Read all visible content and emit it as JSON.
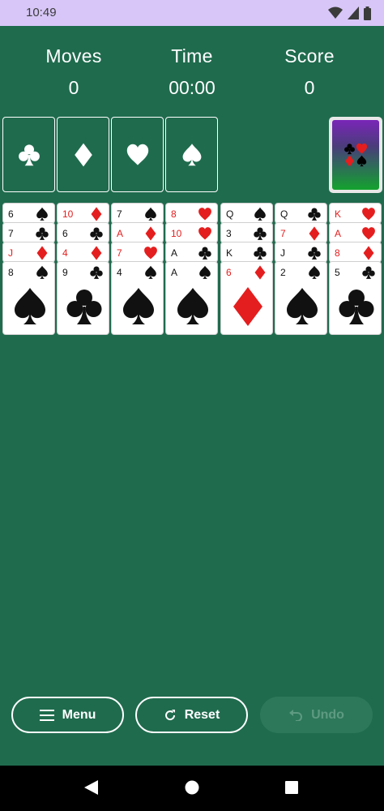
{
  "status_bar": {
    "time": "10:49"
  },
  "stats": {
    "moves": {
      "label": "Moves",
      "value": "0"
    },
    "time": {
      "label": "Time",
      "value": "00:00"
    },
    "score": {
      "label": "Score",
      "value": "0"
    }
  },
  "foundations": [
    "clubs",
    "diamonds",
    "hearts",
    "spades"
  ],
  "stock": {
    "back_icon": "four-suits-icon",
    "back_gradient": [
      "#7a25b8",
      "#14a22e"
    ]
  },
  "tableau": [
    {
      "cards": [
        {
          "rank": "6",
          "suit": "spades"
        },
        {
          "rank": "7",
          "suit": "clubs"
        },
        {
          "rank": "J",
          "suit": "diamonds"
        },
        {
          "rank": "8",
          "suit": "spades"
        }
      ]
    },
    {
      "cards": [
        {
          "rank": "10",
          "suit": "diamonds"
        },
        {
          "rank": "6",
          "suit": "clubs"
        },
        {
          "rank": "4",
          "suit": "diamonds"
        },
        {
          "rank": "9",
          "suit": "clubs"
        }
      ]
    },
    {
      "cards": [
        {
          "rank": "7",
          "suit": "spades"
        },
        {
          "rank": "A",
          "suit": "diamonds"
        },
        {
          "rank": "7",
          "suit": "hearts"
        },
        {
          "rank": "4",
          "suit": "spades"
        }
      ]
    },
    {
      "cards": [
        {
          "rank": "8",
          "suit": "hearts"
        },
        {
          "rank": "10",
          "suit": "hearts"
        },
        {
          "rank": "A",
          "suit": "clubs"
        },
        {
          "rank": "A",
          "suit": "spades"
        }
      ]
    },
    {
      "cards": [
        {
          "rank": "Q",
          "suit": "spades"
        },
        {
          "rank": "3",
          "suit": "clubs"
        },
        {
          "rank": "K",
          "suit": "clubs"
        },
        {
          "rank": "6",
          "suit": "diamonds"
        }
      ]
    },
    {
      "cards": [
        {
          "rank": "Q",
          "suit": "clubs"
        },
        {
          "rank": "7",
          "suit": "diamonds"
        },
        {
          "rank": "J",
          "suit": "clubs"
        },
        {
          "rank": "2",
          "suit": "spades"
        }
      ]
    },
    {
      "cards": [
        {
          "rank": "K",
          "suit": "hearts"
        },
        {
          "rank": "A",
          "suit": "hearts"
        },
        {
          "rank": "8",
          "suit": "diamonds"
        },
        {
          "rank": "5",
          "suit": "clubs"
        }
      ]
    }
  ],
  "buttons": {
    "menu": {
      "label": "Menu",
      "icon": "hamburger-icon"
    },
    "reset": {
      "label": "Reset",
      "icon": "refresh-icon"
    },
    "undo": {
      "label": "Undo",
      "icon": "undo-icon",
      "enabled": false
    }
  },
  "colors": {
    "felt": "#1f6b4e",
    "red_suit": "#e41e1e",
    "black_suit": "#111111",
    "status_bar": "#d7c6f7"
  }
}
